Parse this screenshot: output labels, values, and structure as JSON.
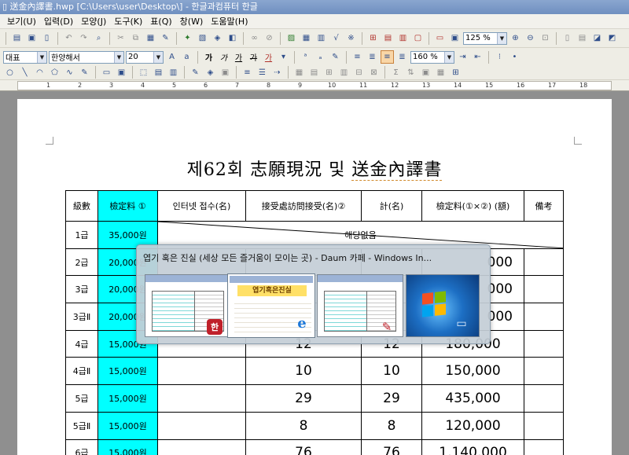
{
  "window": {
    "title": "▯ 送金內譯書.hwp [C:\\Users\\user\\Desktop\\] - 한글과컴퓨터 한글"
  },
  "menu": [
    "보기(U)",
    "입력(D)",
    "모양(J)",
    "도구(K)",
    "표(Q)",
    "창(W)",
    "도움말(H)"
  ],
  "toolbar": {
    "zoom": "125 %",
    "style": "대표",
    "font": "한양해서",
    "font_size": "20",
    "para_zoom": "160 %"
  },
  "ruler": {
    "ticks": [
      "1",
      "2",
      "3",
      "4",
      "5",
      "6",
      "7",
      "8",
      "9",
      "10",
      "11",
      "12",
      "13",
      "14",
      "15",
      "16",
      "17",
      "18"
    ]
  },
  "document": {
    "title_prefix": "제62회  志願現況  및 ",
    "title_underlined": "送金內譯書",
    "table": {
      "headers": [
        "級數",
        "檢定料 ①",
        "인터넷 접수(名)",
        "接受處訪問接受(名)②",
        "計(名)",
        "檢定料(①×②) (額)",
        "備考"
      ],
      "not_applicable": "해당없음",
      "rows": [
        {
          "grade": "1급",
          "fee": "35,000원",
          "online": "",
          "visit": "",
          "total": "",
          "amount": "",
          "note": ""
        },
        {
          "grade": "2급",
          "fee": "20,000원",
          "online": "",
          "visit": "",
          "total": "",
          "amount": "000",
          "note": ""
        },
        {
          "grade": "3급",
          "fee": "20,000원",
          "online": "",
          "visit": "",
          "total": "",
          "amount": "000",
          "note": ""
        },
        {
          "grade": "3급Ⅱ",
          "fee": "20,000원",
          "online": "",
          "visit": "",
          "total": "",
          "amount": "000",
          "note": ""
        },
        {
          "grade": "4급",
          "fee": "15,000원",
          "online": "",
          "visit": "12",
          "total": "12",
          "amount": "180,000",
          "note": ""
        },
        {
          "grade": "4급Ⅱ",
          "fee": "15,000원",
          "online": "",
          "visit": "10",
          "total": "10",
          "amount": "150,000",
          "note": ""
        },
        {
          "grade": "5급",
          "fee": "15,000원",
          "online": "",
          "visit": "29",
          "total": "29",
          "amount": "435,000",
          "note": ""
        },
        {
          "grade": "5급Ⅱ",
          "fee": "15,000원",
          "online": "",
          "visit": "8",
          "total": "8",
          "amount": "120,000",
          "note": ""
        },
        {
          "grade": "6급",
          "fee": "15,000원",
          "online": "",
          "visit": "76",
          "total": "76",
          "amount": "1,140,000",
          "note": ""
        }
      ]
    }
  },
  "taskbar_preview": {
    "title": "엽기 혹은 진실 (세상 모든 즐거움이 모이는 곳) - Daum 카페 - Windows In...",
    "cafe_banner": "엽기혹은진실",
    "hwp_badge": "한",
    "ie_badge": "e"
  },
  "colors": {
    "highlight_cell": "#00ffff",
    "page_bg": "#ffffff",
    "workspace": "#8f8f8f"
  }
}
